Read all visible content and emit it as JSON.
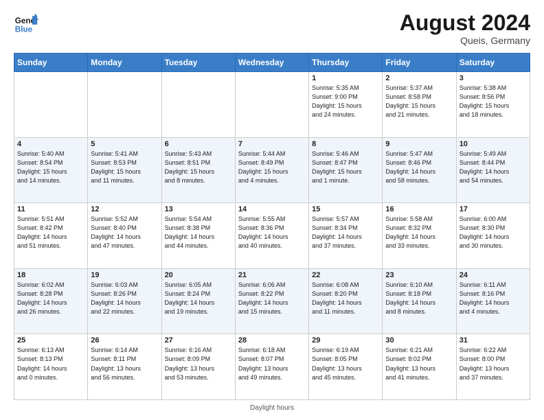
{
  "header": {
    "logo_general": "General",
    "logo_blue": "Blue",
    "month_title": "August 2024",
    "location": "Queis, Germany"
  },
  "days_of_week": [
    "Sunday",
    "Monday",
    "Tuesday",
    "Wednesday",
    "Thursday",
    "Friday",
    "Saturday"
  ],
  "weeks": [
    [
      {
        "day": "",
        "info": ""
      },
      {
        "day": "",
        "info": ""
      },
      {
        "day": "",
        "info": ""
      },
      {
        "day": "",
        "info": ""
      },
      {
        "day": "1",
        "info": "Sunrise: 5:35 AM\nSunset: 9:00 PM\nDaylight: 15 hours\nand 24 minutes."
      },
      {
        "day": "2",
        "info": "Sunrise: 5:37 AM\nSunset: 8:58 PM\nDaylight: 15 hours\nand 21 minutes."
      },
      {
        "day": "3",
        "info": "Sunrise: 5:38 AM\nSunset: 8:56 PM\nDaylight: 15 hours\nand 18 minutes."
      }
    ],
    [
      {
        "day": "4",
        "info": "Sunrise: 5:40 AM\nSunset: 8:54 PM\nDaylight: 15 hours\nand 14 minutes."
      },
      {
        "day": "5",
        "info": "Sunrise: 5:41 AM\nSunset: 8:53 PM\nDaylight: 15 hours\nand 11 minutes."
      },
      {
        "day": "6",
        "info": "Sunrise: 5:43 AM\nSunset: 8:51 PM\nDaylight: 15 hours\nand 8 minutes."
      },
      {
        "day": "7",
        "info": "Sunrise: 5:44 AM\nSunset: 8:49 PM\nDaylight: 15 hours\nand 4 minutes."
      },
      {
        "day": "8",
        "info": "Sunrise: 5:46 AM\nSunset: 8:47 PM\nDaylight: 15 hours\nand 1 minute."
      },
      {
        "day": "9",
        "info": "Sunrise: 5:47 AM\nSunset: 8:46 PM\nDaylight: 14 hours\nand 58 minutes."
      },
      {
        "day": "10",
        "info": "Sunrise: 5:49 AM\nSunset: 8:44 PM\nDaylight: 14 hours\nand 54 minutes."
      }
    ],
    [
      {
        "day": "11",
        "info": "Sunrise: 5:51 AM\nSunset: 8:42 PM\nDaylight: 14 hours\nand 51 minutes."
      },
      {
        "day": "12",
        "info": "Sunrise: 5:52 AM\nSunset: 8:40 PM\nDaylight: 14 hours\nand 47 minutes."
      },
      {
        "day": "13",
        "info": "Sunrise: 5:54 AM\nSunset: 8:38 PM\nDaylight: 14 hours\nand 44 minutes."
      },
      {
        "day": "14",
        "info": "Sunrise: 5:55 AM\nSunset: 8:36 PM\nDaylight: 14 hours\nand 40 minutes."
      },
      {
        "day": "15",
        "info": "Sunrise: 5:57 AM\nSunset: 8:34 PM\nDaylight: 14 hours\nand 37 minutes."
      },
      {
        "day": "16",
        "info": "Sunrise: 5:58 AM\nSunset: 8:32 PM\nDaylight: 14 hours\nand 33 minutes."
      },
      {
        "day": "17",
        "info": "Sunrise: 6:00 AM\nSunset: 8:30 PM\nDaylight: 14 hours\nand 30 minutes."
      }
    ],
    [
      {
        "day": "18",
        "info": "Sunrise: 6:02 AM\nSunset: 8:28 PM\nDaylight: 14 hours\nand 26 minutes."
      },
      {
        "day": "19",
        "info": "Sunrise: 6:03 AM\nSunset: 8:26 PM\nDaylight: 14 hours\nand 22 minutes."
      },
      {
        "day": "20",
        "info": "Sunrise: 6:05 AM\nSunset: 8:24 PM\nDaylight: 14 hours\nand 19 minutes."
      },
      {
        "day": "21",
        "info": "Sunrise: 6:06 AM\nSunset: 8:22 PM\nDaylight: 14 hours\nand 15 minutes."
      },
      {
        "day": "22",
        "info": "Sunrise: 6:08 AM\nSunset: 8:20 PM\nDaylight: 14 hours\nand 11 minutes."
      },
      {
        "day": "23",
        "info": "Sunrise: 6:10 AM\nSunset: 8:18 PM\nDaylight: 14 hours\nand 8 minutes."
      },
      {
        "day": "24",
        "info": "Sunrise: 6:11 AM\nSunset: 8:16 PM\nDaylight: 14 hours\nand 4 minutes."
      }
    ],
    [
      {
        "day": "25",
        "info": "Sunrise: 6:13 AM\nSunset: 8:13 PM\nDaylight: 14 hours\nand 0 minutes."
      },
      {
        "day": "26",
        "info": "Sunrise: 6:14 AM\nSunset: 8:11 PM\nDaylight: 13 hours\nand 56 minutes."
      },
      {
        "day": "27",
        "info": "Sunrise: 6:16 AM\nSunset: 8:09 PM\nDaylight: 13 hours\nand 53 minutes."
      },
      {
        "day": "28",
        "info": "Sunrise: 6:18 AM\nSunset: 8:07 PM\nDaylight: 13 hours\nand 49 minutes."
      },
      {
        "day": "29",
        "info": "Sunrise: 6:19 AM\nSunset: 8:05 PM\nDaylight: 13 hours\nand 45 minutes."
      },
      {
        "day": "30",
        "info": "Sunrise: 6:21 AM\nSunset: 8:02 PM\nDaylight: 13 hours\nand 41 minutes."
      },
      {
        "day": "31",
        "info": "Sunrise: 6:22 AM\nSunset: 8:00 PM\nDaylight: 13 hours\nand 37 minutes."
      }
    ]
  ],
  "footer": {
    "note": "Daylight hours"
  }
}
